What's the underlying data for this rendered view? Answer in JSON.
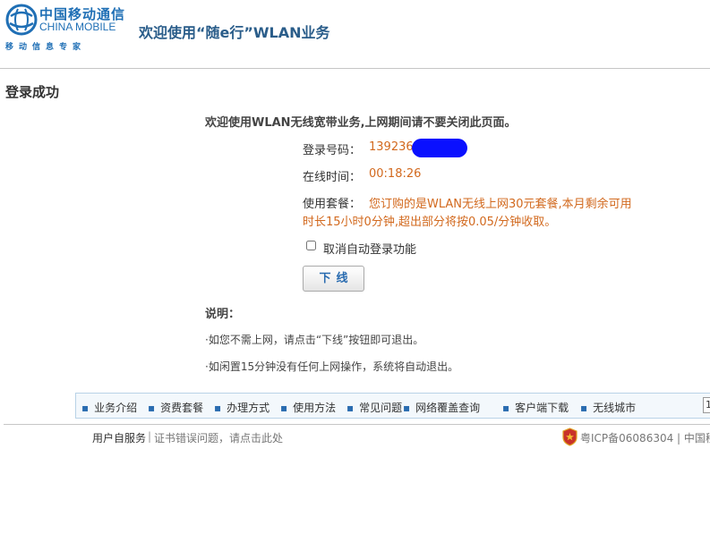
{
  "header": {
    "logo_cn": "中国移动通信",
    "logo_en": "CHINA MOBILE",
    "logo_sub": "移动信息专家",
    "title": "欢迎使用“随e行”WLAN业务"
  },
  "page_title": "登录成功",
  "welcome": "欢迎使用WLAN无线宽带业务,上网期间请不要关闭此页面。",
  "info": {
    "login_label": "登录号码：",
    "login_value": "139236",
    "online_label": "在线时间：",
    "online_value": "00:18:26",
    "plan_label": "使用套餐：",
    "plan_line1": "您订购的是WLAN无线上网30元套餐,本月剩余可用",
    "plan_line2": "时长15小时0分钟,超出部分将按0.05/分钟收取。"
  },
  "auto_login_label": "取消自动登录功能",
  "logout_button": "下线",
  "notes": {
    "title": "说明：",
    "items": [
      "·如您不需上网，请点击“下线”按钮即可退出。",
      "·如闲置15分钟没有任何上网操作，系统将自动退出。"
    ]
  },
  "nav": {
    "items": [
      "业务介绍",
      "资费套餐",
      "办理方式",
      "使用方法",
      "常见问题",
      "网络覆盖查询",
      "客户端下载",
      "无线城市"
    ],
    "box_text": "1"
  },
  "footer": {
    "self_service": "用户自服务",
    "separator": "|",
    "cert_text": "证书错误问题，请点击此处",
    "icp": "粤ICP备06086304 | 中国移"
  },
  "colors": {
    "brand_blue": "#1f6fb5",
    "value_orange": "#d2691e",
    "redaction": "#0a10ff"
  }
}
